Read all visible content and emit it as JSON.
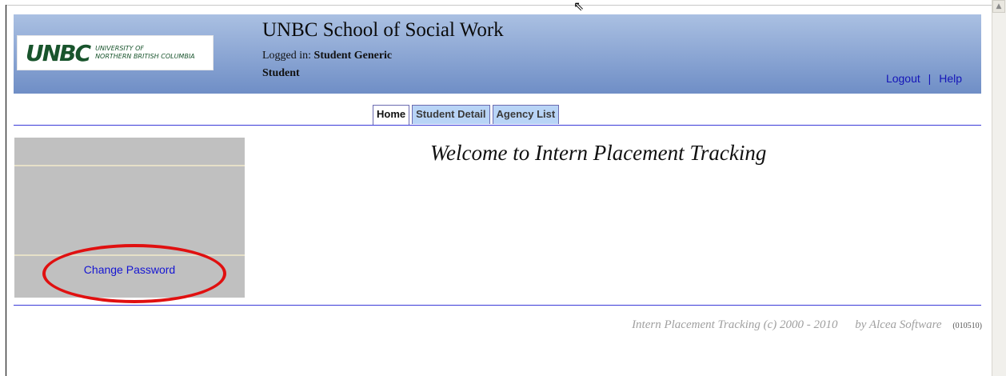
{
  "header": {
    "logo_mark": "UNBC",
    "logo_line1": "UNIVERSITY OF",
    "logo_line2": "NORTHERN BRITISH COLUMBIA",
    "title": "UNBC School of Social Work",
    "logged_in_label": "Logged in:",
    "logged_in_user": "Student Generic",
    "role": "Student",
    "links": {
      "logout": "Logout",
      "separator": "|",
      "help": "Help"
    }
  },
  "tabs": [
    {
      "label": "Home",
      "active": true
    },
    {
      "label": "Student Detail",
      "active": false
    },
    {
      "label": "Agency List",
      "active": false
    }
  ],
  "sidebar": {
    "change_password": "Change Password"
  },
  "main": {
    "welcome": "Welcome to Intern Placement Tracking"
  },
  "footer": {
    "copyright": "Intern Placement Tracking (c) 2000 - 2010",
    "by": "by Alcea Software",
    "code": "(010510)"
  },
  "colors": {
    "header_gradient_top": "#aac0e2",
    "header_gradient_bottom": "#6f8ec6",
    "link": "#1515d2",
    "highlight": "#e01010",
    "sidebar_bg": "#c0c0c0"
  },
  "icons": {
    "cursor": "mouse-pointer-icon",
    "scroll_up": "scroll-up-arrow-icon"
  }
}
